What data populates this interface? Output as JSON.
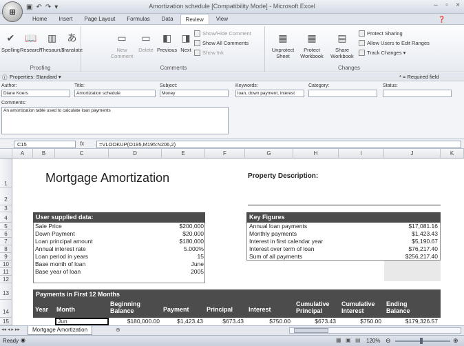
{
  "window": {
    "title": "Amortization schedule  [Compatibility Mode] - Microsoft Excel",
    "office_button": "⊞",
    "min": "–",
    "restore": "▫",
    "close": "×"
  },
  "ribbon": {
    "tabs": [
      "Home",
      "Insert",
      "Page Layout",
      "Formulas",
      "Data",
      "Review",
      "View"
    ],
    "active_tab": "Review",
    "proofing": {
      "label": "Proofing",
      "spelling": "Spelling",
      "research": "Research",
      "thesaurus": "Thesaurus",
      "translate": "Translate"
    },
    "comments": {
      "label": "Comments",
      "new_comment": "New Comment",
      "delete": "Delete",
      "previous": "Previous",
      "next": "Next",
      "show_hide": "Show/Hide Comment",
      "show_all": "Show All Comments",
      "show_ink": "Show Ink"
    },
    "changes": {
      "label": "Changes",
      "unprotect_sheet": "Unprotect Sheet",
      "protect_workbook": "Protect Workbook",
      "share_workbook": "Share Workbook",
      "protect_sharing": "Protect Sharing",
      "allow_users": "Allow Users to Edit Ranges",
      "track_changes": "Track Changes ▾"
    }
  },
  "properties": {
    "bar_label": "Properties: Standard ▾",
    "required": "* = Required field",
    "author_label": "Author:",
    "author": "Diane Koers",
    "title_label": "Title:",
    "title": "Amortization schedule",
    "subject_label": "Subject:",
    "subject": "Money",
    "keywords_label": "Keywords:",
    "keywords": "loan, down payment, interest",
    "category_label": "Category:",
    "category": "",
    "status_label": "Status:",
    "status": "",
    "comments_label": "Comments:",
    "comments": "An amortization table used to calculate loan payments"
  },
  "formula_bar": {
    "name_box": "C15",
    "fx": "fx",
    "formula": "=VLOOKUP(O195,M195:N206,2)"
  },
  "grid": {
    "columns": [
      "A",
      "B",
      "C",
      "D",
      "E",
      "F",
      "G",
      "H",
      "I",
      "J",
      "K"
    ],
    "rows": [
      "1",
      "2",
      "3",
      "4",
      "5",
      "6",
      "7",
      "8",
      "9",
      "10",
      "11",
      "12",
      "13",
      "14",
      "15"
    ]
  },
  "sheet": {
    "title": "Mortgage Amortization",
    "property_description": "Property Description:",
    "user_data_header": "User supplied data:",
    "user_data": [
      {
        "label": "Sale Price",
        "value": "$200,000"
      },
      {
        "label": "Down Payment",
        "value": "$20,000"
      },
      {
        "label": "Loan principal amount",
        "value": "$180,000"
      },
      {
        "label": "Annual interest rate",
        "value": "5.000%"
      },
      {
        "label": "Loan period in years",
        "value": "15"
      },
      {
        "label": "Base month of loan",
        "value": "June"
      },
      {
        "label": "Base year of loan",
        "value": "2005"
      }
    ],
    "key_figures_header": "Key Figures",
    "key_figures": [
      {
        "label": "Annual loan payments",
        "value": "$17,081.16"
      },
      {
        "label": "Monthly payments",
        "value": "$1,423.43"
      },
      {
        "label": "Interest in first calendar year",
        "value": "$5,190.67"
      },
      {
        "label": "Interest over term of loan",
        "value": "$76,217.40"
      },
      {
        "label": "Sum of all payments",
        "value": "$256,217.40"
      }
    ],
    "payments_header": "Payments in First 12 Months",
    "payment_columns": {
      "year": "Year",
      "month": "Month",
      "beg_balance": "Beginning Balance",
      "payment": "Payment",
      "principal": "Principal",
      "interest": "Interest",
      "cum_principal": "Cumulative Principal",
      "cum_interest": "Cumulative Interest",
      "end_balance": "Ending Balance"
    },
    "first_row": {
      "month": "Jun",
      "beg_balance": "$180,000.00",
      "payment": "$1,423.43",
      "principal": "$673.43",
      "interest": "$750.00",
      "cum_principal": "$673.43",
      "cum_interest": "$750.00",
      "end_balance": "$179,326.57"
    }
  },
  "sheet_tabs": {
    "active": "Mortgage Amortization"
  },
  "status_bar": {
    "ready": "Ready",
    "zoom": "120%"
  }
}
